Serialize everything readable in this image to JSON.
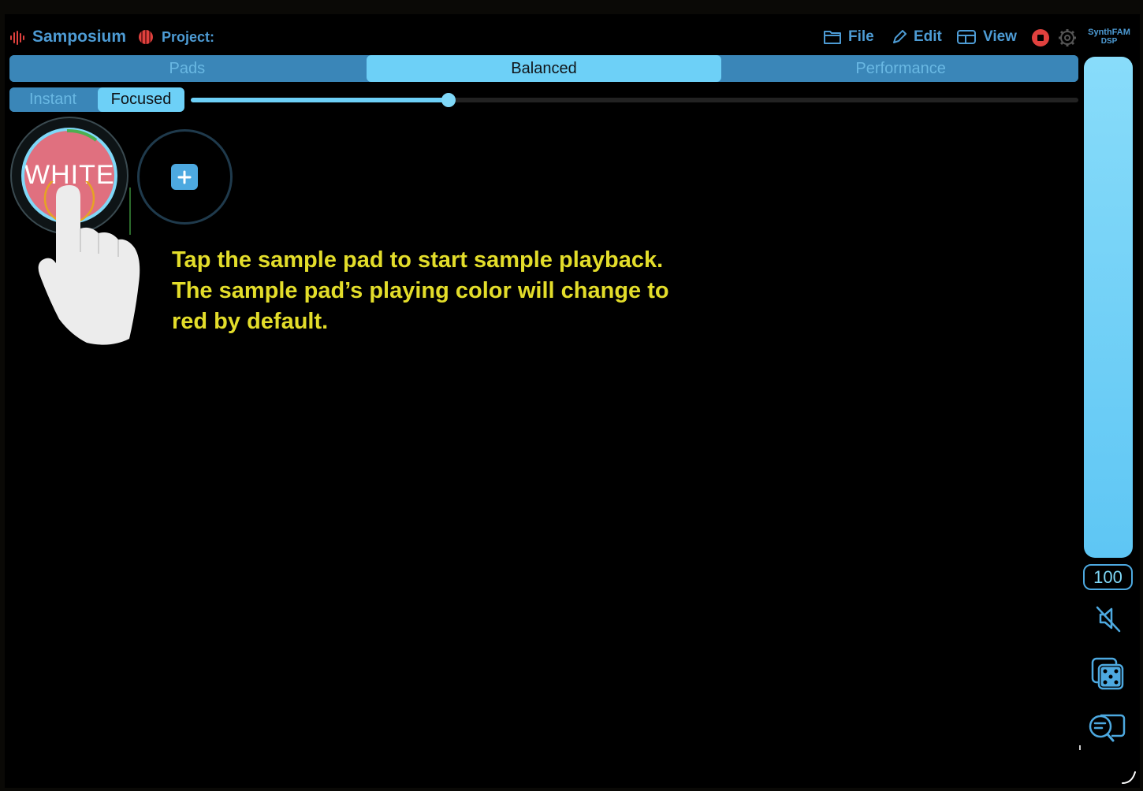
{
  "header": {
    "app_title": "Samposium",
    "project_label": "Project:",
    "menu": [
      {
        "label": "File",
        "icon": "folder-icon"
      },
      {
        "label": "Edit",
        "icon": "pencil-icon"
      },
      {
        "label": "View",
        "icon": "layout-icon"
      }
    ],
    "brand_line1": "SynthFAM",
    "brand_line2": "DSP"
  },
  "tabs": [
    {
      "label": "Pads",
      "active": false
    },
    {
      "label": "Balanced",
      "active": true
    },
    {
      "label": "Performance",
      "active": false
    }
  ],
  "mode": {
    "options": [
      {
        "label": "Instant",
        "active": false
      },
      {
        "label": "Focused",
        "active": true
      }
    ],
    "slider_value": 0.29
  },
  "pads": [
    {
      "label": "WHITE_I",
      "playing": true
    }
  ],
  "tutorial": {
    "lines": [
      "Tap the sample pad to start sample playback.",
      "The sample pad’s playing color will change to",
      "red by default."
    ]
  },
  "volume": {
    "value": "100",
    "level": 1.0
  },
  "colors": {
    "accent": "#4d9bd4",
    "tab_active": "#6dd0f7",
    "pad_playing": "#e0707f",
    "caption": "#e3dd2a",
    "record": "#e0413e"
  }
}
